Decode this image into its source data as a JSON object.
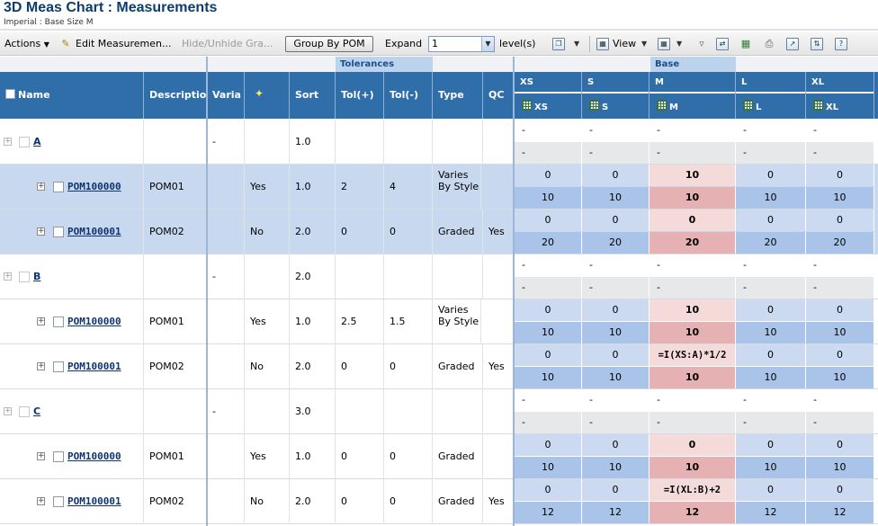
{
  "page": {
    "title": "3D Meas Chart : Measurements",
    "subtitle": "Imperial : Base Size M"
  },
  "toolbar": {
    "actions": "Actions",
    "edit": "Edit Measuremen...",
    "hide": "Hide/Unhide Gra...",
    "group_by": "Group By POM",
    "expand_label": "Expand",
    "expand_value": "1",
    "levels": "level(s)",
    "view": "View"
  },
  "groups": {
    "tolerances": "Tolerances",
    "base": "Base"
  },
  "columns": {
    "name": "Name",
    "description": "Descriptio",
    "variance": "Varia",
    "sort": "Sort",
    "tol_plus": "Tol(+)",
    "tol_minus": "Tol(-)",
    "type": "Type",
    "qc": "QC",
    "sizes": [
      "XS",
      "S",
      "M",
      "L",
      "XL"
    ]
  },
  "rows": [
    {
      "kind": "parent",
      "name": "A",
      "desc": "",
      "var": "-",
      "flag": "",
      "sort": "1.0",
      "tolp": "",
      "tolm": "",
      "type": "",
      "qc": "",
      "top": [
        "-",
        "-",
        "-",
        "-",
        "-"
      ],
      "bot": [
        "-",
        "-",
        "-",
        "-",
        "-"
      ]
    },
    {
      "kind": "child",
      "name": "POM100000",
      "desc": "POM01",
      "var": "",
      "flag": "Yes",
      "sort": "1.0",
      "tolp": "2",
      "tolm": "4",
      "type": "Varies By Style",
      "qc": "",
      "top": [
        "0",
        "0",
        "10",
        "0",
        "0"
      ],
      "bot": [
        "10",
        "10",
        "10",
        "10",
        "10"
      ]
    },
    {
      "kind": "child",
      "name": "POM100001",
      "desc": "POM02",
      "var": "",
      "flag": "No",
      "sort": "2.0",
      "tolp": "0",
      "tolm": "0",
      "type": "Graded",
      "qc": "Yes",
      "top": [
        "0",
        "0",
        "0",
        "0",
        "0"
      ],
      "bot": [
        "20",
        "20",
        "20",
        "20",
        "20"
      ]
    },
    {
      "kind": "parent",
      "name": "B",
      "desc": "",
      "var": "-",
      "flag": "",
      "sort": "2.0",
      "tolp": "",
      "tolm": "",
      "type": "",
      "qc": "",
      "top": [
        "-",
        "-",
        "-",
        "-",
        "-"
      ],
      "bot": [
        "-",
        "-",
        "-",
        "-",
        "-"
      ]
    },
    {
      "kind": "child",
      "name": "POM100000",
      "desc": "POM01",
      "var": "",
      "flag": "Yes",
      "sort": "1.0",
      "tolp": "2.5",
      "tolm": "1.5",
      "type": "Varies By Style",
      "qc": "",
      "top": [
        "0",
        "0",
        "10",
        "0",
        "0"
      ],
      "bot": [
        "10",
        "10",
        "10",
        "10",
        "10"
      ]
    },
    {
      "kind": "child",
      "name": "POM100001",
      "desc": "POM02",
      "var": "",
      "flag": "No",
      "sort": "2.0",
      "tolp": "0",
      "tolm": "0",
      "type": "Graded",
      "qc": "Yes",
      "top": [
        "0",
        "0",
        "=I(XS:A)*1/2",
        "0",
        "0"
      ],
      "bot": [
        "10",
        "10",
        "10",
        "10",
        "10"
      ]
    },
    {
      "kind": "parent",
      "name": "C",
      "desc": "",
      "var": "-",
      "flag": "",
      "sort": "3.0",
      "tolp": "",
      "tolm": "",
      "type": "",
      "qc": "",
      "top": [
        "-",
        "-",
        "-",
        "-",
        "-"
      ],
      "bot": [
        "-",
        "-",
        "-",
        "-",
        "-"
      ]
    },
    {
      "kind": "child",
      "name": "POM100000",
      "desc": "POM01",
      "var": "",
      "flag": "Yes",
      "sort": "1.0",
      "tolp": "0",
      "tolm": "0",
      "type": "Graded",
      "qc": "",
      "top": [
        "0",
        "0",
        "0",
        "0",
        "0"
      ],
      "bot": [
        "10",
        "10",
        "10",
        "10",
        "10"
      ]
    },
    {
      "kind": "child",
      "name": "POM100001",
      "desc": "POM02",
      "var": "",
      "flag": "No",
      "sort": "2.0",
      "tolp": "0",
      "tolm": "0",
      "type": "Graded",
      "qc": "Yes",
      "top": [
        "0",
        "0",
        "=I(XL:B)+2",
        "0",
        "0"
      ],
      "bot": [
        "12",
        "12",
        "12",
        "12",
        "12"
      ]
    }
  ]
}
